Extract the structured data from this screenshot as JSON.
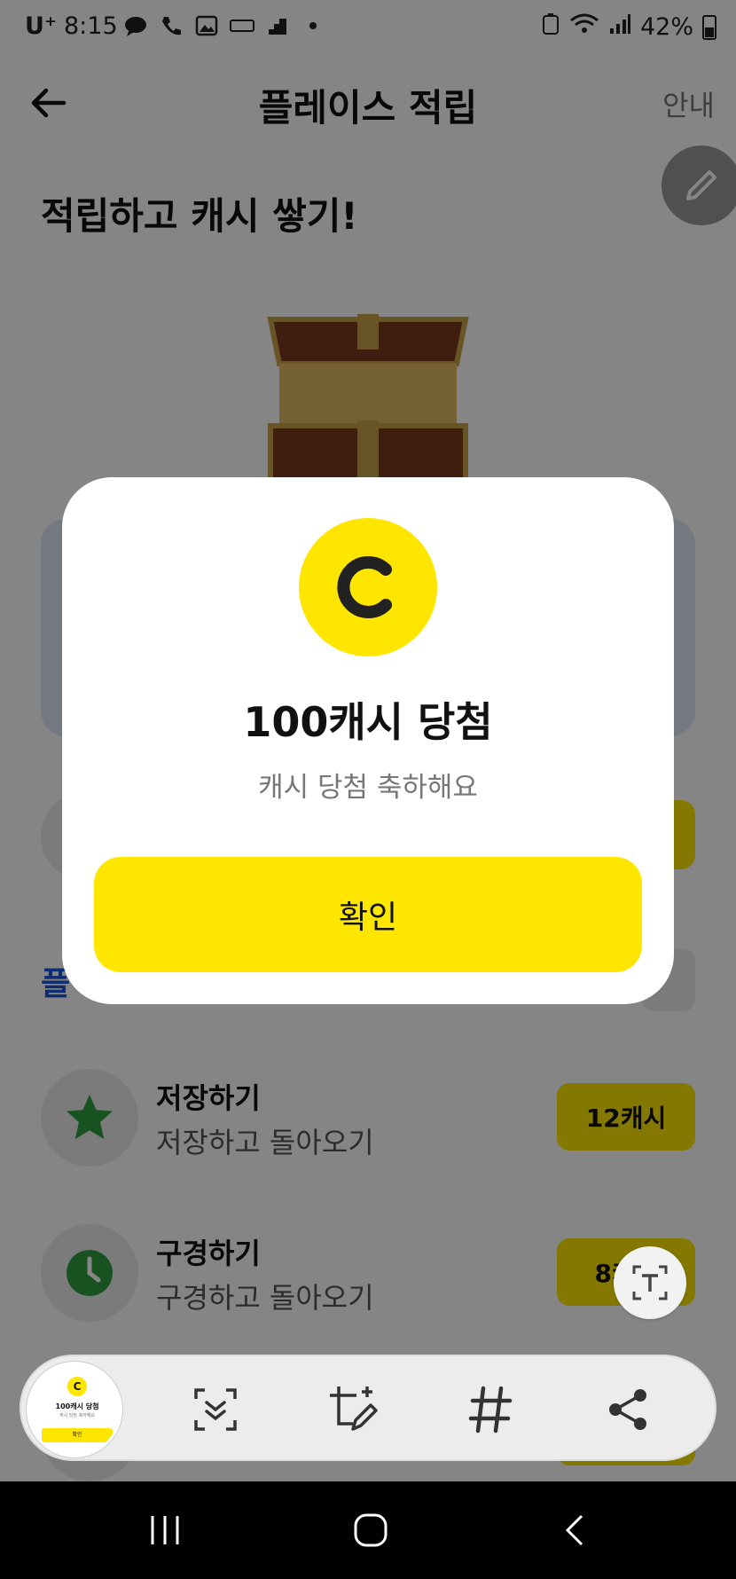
{
  "status_bar": {
    "carrier": "U⁺",
    "time": "8:15",
    "battery": "42%"
  },
  "header": {
    "title": "플레이스 적립",
    "info_link": "안내"
  },
  "promo": {
    "title": "적립하고 캐시 쌓기!"
  },
  "background": {
    "partial_label": "플"
  },
  "missions": [
    {
      "title": "저장하기",
      "subtitle": "저장하고 돌아오기",
      "reward": "12캐시",
      "icon": "star-icon"
    },
    {
      "title": "구경하기",
      "subtitle": "구경하고 돌아오기",
      "reward": "8캐시",
      "icon": "clock-icon"
    }
  ],
  "modal": {
    "coin_letter": "C",
    "title": "100캐시 당첨",
    "subtitle": "캐시 당첨 축하해요",
    "confirm_label": "확인"
  },
  "thumbnail": {
    "coin_letter": "C",
    "title": "100캐시 당첨",
    "subtitle": "캐시 당첨 축하해요",
    "button": "확인"
  },
  "colors": {
    "accent_yellow": "#ffe600",
    "star_green": "#2e9e3e",
    "link_blue": "#1a56d6"
  }
}
